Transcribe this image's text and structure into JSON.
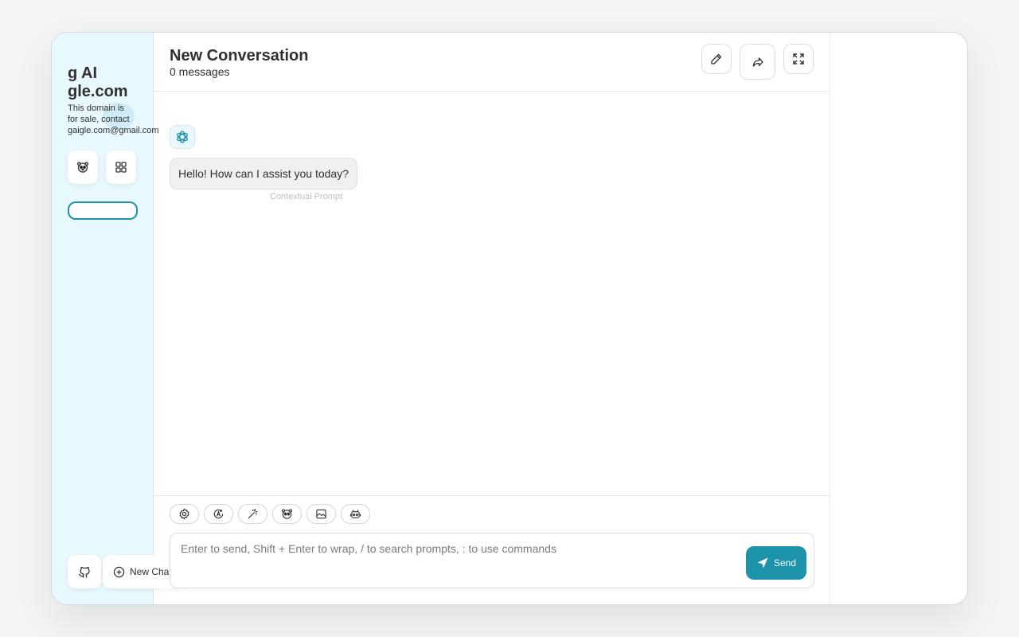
{
  "sidebar": {
    "title": "g AI\ngle.com",
    "subtitle": "This domain is\nfor sale, contact\ngaigle.com@gmail.com",
    "buttons": [
      {
        "icon": "mask-icon"
      },
      {
        "icon": "apps-grid-icon"
      }
    ],
    "github_icon": "github-icon",
    "new_chat_label": "New Chat"
  },
  "header": {
    "title": "New Conversation",
    "subtitle": "0 messages",
    "actions": [
      "edit-icon",
      "share-icon",
      "fullscreen-icon"
    ]
  },
  "messages": [
    {
      "role": "assistant",
      "avatar_icon": "openai-icon",
      "text": "Hello! How can I assist you today?",
      "meta": "Contextual Prompt"
    }
  ],
  "input": {
    "placeholder": "Enter to send, Shift + Enter to wrap, / to search prompts, : to use commands",
    "value": "",
    "send_label": "Send",
    "actions": [
      "settings-icon",
      "theme-auto-icon",
      "magic-wand-icon",
      "mask-icon",
      "image-icon",
      "robot-icon"
    ]
  },
  "colors": {
    "accent": "#1d93ab",
    "sidebar_bg": "#e7f8ff"
  }
}
